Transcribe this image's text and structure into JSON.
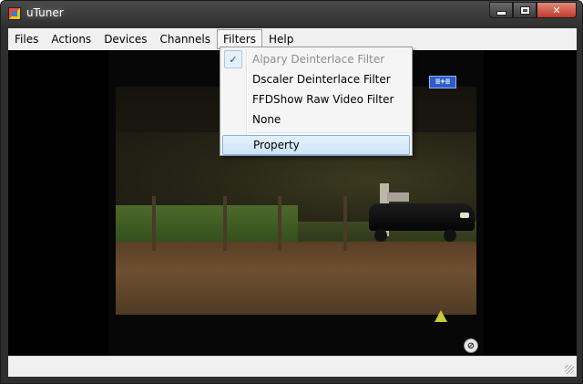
{
  "window": {
    "title": "uTuner",
    "close_glyph": "✕"
  },
  "menubar": {
    "items": [
      "Files",
      "Actions",
      "Devices",
      "Channels",
      "Filters",
      "Help"
    ]
  },
  "filters_menu": {
    "items": [
      {
        "label": "Alpary Deinterlace Filter",
        "checked": true,
        "enabled": false
      },
      {
        "label": "Dscaler Deinterlace Filter",
        "checked": false,
        "enabled": true
      },
      {
        "label": "FFDShow Raw Video Filter",
        "checked": false,
        "enabled": true
      },
      {
        "label": "None",
        "checked": false,
        "enabled": true
      },
      {
        "label": "Property",
        "checked": false,
        "enabled": true,
        "highlighted": true
      }
    ],
    "check_glyph": "✓"
  },
  "video": {
    "channel_logo": "≡+≡"
  },
  "colors": {
    "menu_highlight": "#cde5f8",
    "close_button": "#c0392b",
    "disabled_text": "#8d8d8d"
  }
}
